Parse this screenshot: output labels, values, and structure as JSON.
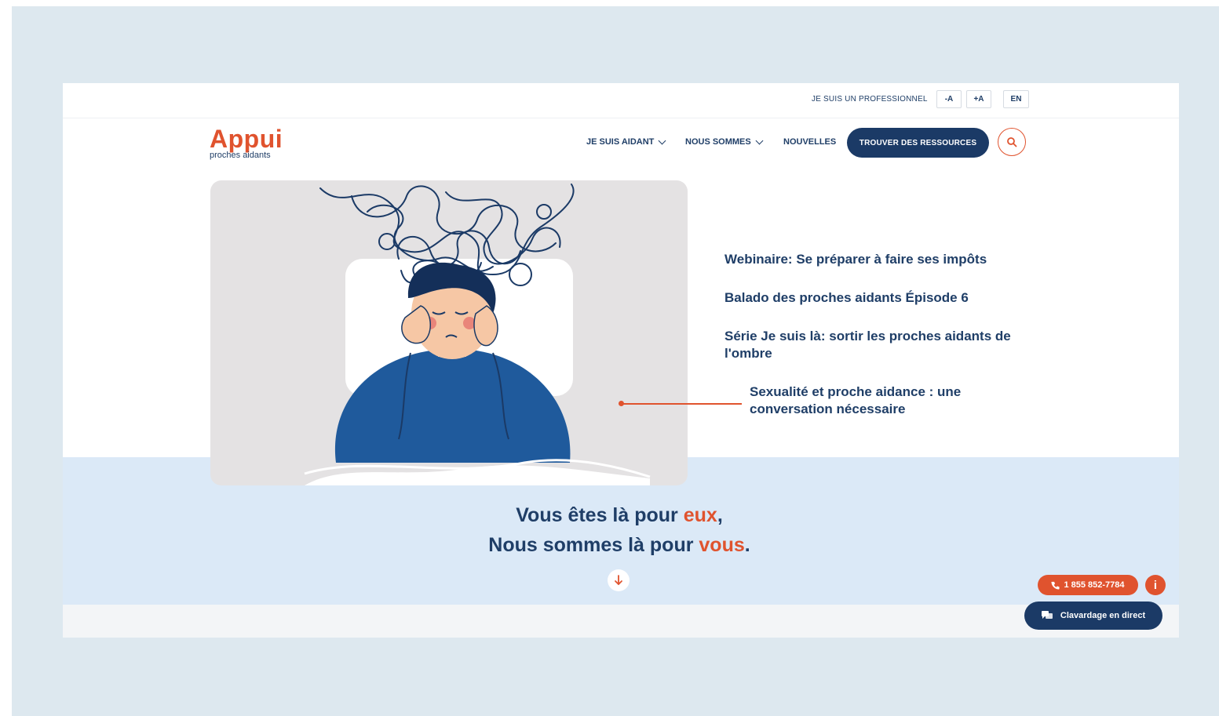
{
  "utility": {
    "pro_link": "JE SUIS UN PROFESSIONNEL",
    "font_decrease": "-A",
    "font_increase": "+A",
    "language": "EN"
  },
  "logo": {
    "name": "Appui",
    "tagline": "proches aidants"
  },
  "nav": {
    "items": [
      {
        "label": "JE SUIS AIDANT",
        "dropdown": true
      },
      {
        "label": "NOUS SOMMES",
        "dropdown": true
      },
      {
        "label": "NOUVELLES",
        "dropdown": false
      }
    ],
    "cta": "TROUVER DES RESSOURCES"
  },
  "hero": {
    "news": [
      {
        "title": "Webinaire: Se préparer à faire ses impôts"
      },
      {
        "title": "Balado des proches aidants Épisode 6"
      },
      {
        "title": "Série Je suis là: sortir les proches aidants de l'ombre"
      },
      {
        "title": "Sexualité et proche aidance : une conversation nécessaire",
        "active": true
      }
    ]
  },
  "tagline": {
    "line1_prefix": "Vous êtes là pour ",
    "line1_accent": "eux",
    "line1_suffix": ",",
    "line2_prefix": "Nous sommes là pour ",
    "line2_accent": "vous",
    "line2_suffix": "."
  },
  "floating": {
    "phone": "1 855 852-7784",
    "info": "i",
    "chat": "Clavardage en direct"
  },
  "colors": {
    "accent": "#e0532e",
    "navy": "#1b3a66",
    "band": "#dbe9f7"
  }
}
